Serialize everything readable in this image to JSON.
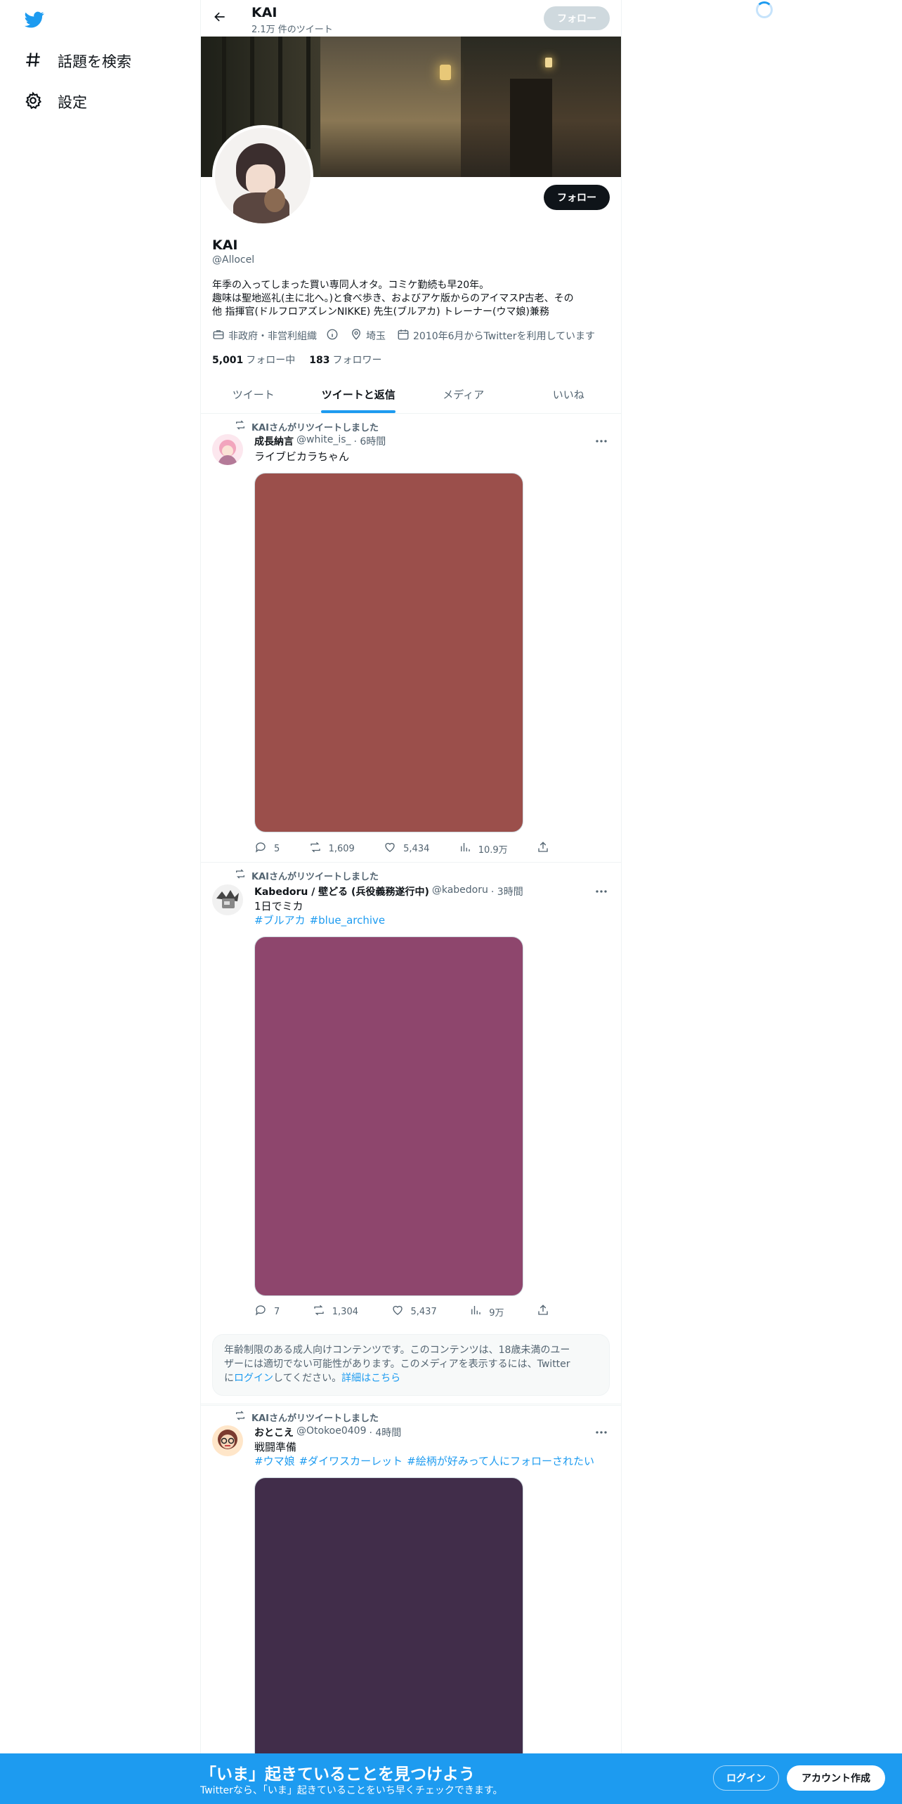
{
  "nav": {
    "logo": "twitter-bird-icon",
    "items": [
      {
        "label": "話題を検索",
        "icon": "hashtag-icon"
      },
      {
        "label": "設定",
        "icon": "gear-icon"
      }
    ]
  },
  "header": {
    "name": "KAI",
    "tweet_count": "2.1万 件のツイート",
    "follow_label": "フォロー"
  },
  "profile": {
    "name": "KAI",
    "handle": "@Allocel",
    "follow_label": "フォロー",
    "bio_lines": [
      "年季の入ってしまった買い専同人オタ。コミケ勤続も早20年。",
      "趣味は聖地巡礼(主に北へ。)と食べ歩き、およびアケ版からのアイマスP古老、その",
      "他 指揮官(ドルフロアズレンNIKKE) 先生(ブルアカ) トレーナー(ウマ娘)兼務"
    ],
    "category": "非政府・非営利組織",
    "location": "埼玉",
    "joined": "2010年6月からTwitterを利用しています",
    "following_count": "5,001",
    "following_label": "フォロー中",
    "followers_count": "183",
    "followers_label": "フォロワー"
  },
  "tabs": [
    {
      "label": "ツイート",
      "active": false
    },
    {
      "label": "ツイートと返信",
      "active": true
    },
    {
      "label": "メディア",
      "active": false
    },
    {
      "label": "いいね",
      "active": false
    }
  ],
  "tweets": [
    {
      "retweet_label": "KAIさんがリツイートしました",
      "name": "成長納言",
      "handle": "@white_is_",
      "time": "· 6時間",
      "text": "ライブビカラちゃん",
      "media_color": "#9b4f4b",
      "replies": "5",
      "retweets": "1,609",
      "likes": "5,434",
      "views": "10.9万"
    },
    {
      "retweet_label": "KAIさんがリツイートしました",
      "name": "Kabedoru / 壁どる (兵役義務遂行中)",
      "handle": "@kabedoru",
      "time": "· 3時間",
      "text": "1日でミカ",
      "tags": [
        "#ブルアカ",
        "#blue_archive"
      ],
      "media_color": "#8e466d",
      "replies": "7",
      "retweets": "1,304",
      "likes": "5,437",
      "views": "9万"
    },
    {
      "retweet_label": "KAIさんがリツイートしました",
      "name": "おとこえ",
      "handle": "@Otokoe0409",
      "time": "· 4時間",
      "text": "戦闘準備",
      "tags": [
        "#ウマ娘",
        "#ダイワスカーレット",
        "#絵柄が好みって人にフォローされたい"
      ],
      "media_color": "#412d4a"
    }
  ],
  "sensitive_notice": {
    "line1": "年齢制限のある成人向けコンテンツです。このコンテンツは、18歳未満のユー",
    "line2": "ザーには適切でない可能性があります。このメディアを表示するには、Twitter",
    "line3_pre": "に",
    "login_link": "ログイン",
    "line3_mid": "してください。",
    "details_link": "詳細はこちら"
  },
  "bottom_bar": {
    "title": "「いま」起きていることを見つけよう",
    "subtitle": "Twitterなら、「いま」起きていることをいち早くチェックできます。",
    "login_label": "ログイン",
    "signup_label": "アカウント作成"
  },
  "colors": {
    "accent": "#1d9bf0",
    "text_primary": "#0f1419",
    "text_secondary": "#536471"
  }
}
